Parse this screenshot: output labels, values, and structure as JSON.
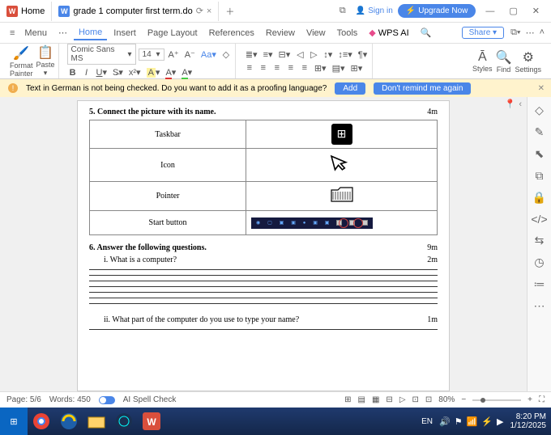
{
  "titlebar": {
    "hometab": "Home",
    "doctab": "grade 1 computer first term.do",
    "signin": "Sign in",
    "upgrade": "Upgrade Now"
  },
  "menu": {
    "menu": "Menu",
    "home": "Home",
    "insert": "Insert",
    "pagelayout": "Page Layout",
    "references": "References",
    "review": "Review",
    "view": "View",
    "tools": "Tools",
    "wpsai": "WPS AI",
    "share": "Share"
  },
  "ribbon": {
    "format_painter": "Format\nPainter",
    "paste": "Paste",
    "font_name": "Comic Sans MS",
    "font_size": "14",
    "styles": "Styles",
    "find": "Find",
    "settings": "Settings"
  },
  "proof": {
    "msg": "Text in German is not being checked. Do you want to add it as a proofing language?",
    "add": "Add",
    "dont": "Don't remind me again"
  },
  "doc": {
    "q5": "5. Connect the picture with its name.",
    "q5_marks": "4m",
    "labels": [
      "Taskbar",
      "Icon",
      "Pointer",
      "Start button"
    ],
    "q6": "6. Answer the following questions.",
    "q6_marks": "9m",
    "q6_i": "i.   What is a computer?",
    "q6_i_marks": "2m",
    "q6_ii": "ii.  What part of the computer do you use to type your name?",
    "q6_ii_marks": "1m"
  },
  "status": {
    "page": "Page: 5/6",
    "words": "Words: 450",
    "spell": "AI Spell Check",
    "zoom": "80%"
  },
  "tray": {
    "lang": "EN",
    "time": "8:20 PM",
    "date": "1/12/2025"
  }
}
